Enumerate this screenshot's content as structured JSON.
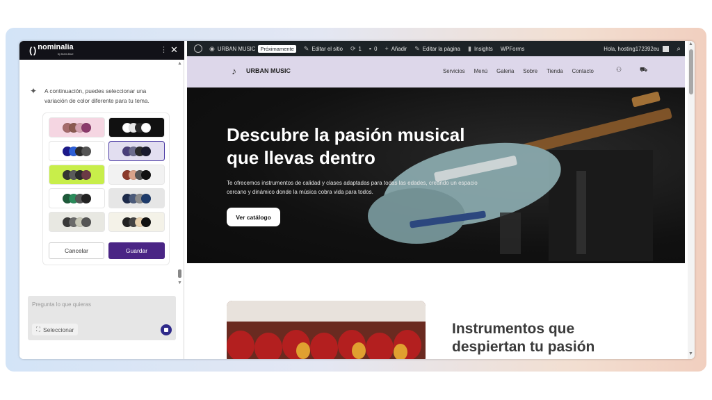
{
  "panel": {
    "brand": "nominalia",
    "brand_sub": "by team.blue",
    "message": "A continuación, puedes seleccionar una variación de color diferente para tu tema.",
    "cancel_label": "Cancelar",
    "save_label": "Guardar",
    "chat_placeholder": "Pregunta lo que quieras",
    "select_label": "Seleccionar",
    "palettes": [
      {
        "bg": "#f5d6e2",
        "colors": [
          "#a56b6b",
          "#8a5a50",
          "#d4a2b0",
          "#8b3a6b"
        ],
        "selected": false
      },
      {
        "bg": "#111111",
        "colors": [
          "#ffffff",
          "#e8e8e8",
          "#2a2a2a",
          "#ffffff"
        ],
        "selected": false
      },
      {
        "bg": "#ffffff",
        "colors": [
          "#1d1a8a",
          "#2d5fd6",
          "#2b2b2b",
          "#555555"
        ],
        "selected": false
      },
      {
        "bg": "#e2def0",
        "colors": [
          "#4a3f7a",
          "#6c6c8c",
          "#2b2b2b",
          "#1a1a2e"
        ],
        "selected": true
      },
      {
        "bg": "#c8ee4a",
        "colors": [
          "#333333",
          "#5a5a5a",
          "#2b2b2b",
          "#6b3a45"
        ],
        "selected": false
      },
      {
        "bg": "#f2f2f2",
        "colors": [
          "#8b3a2b",
          "#d9a38a",
          "#555555",
          "#111111"
        ],
        "selected": false
      },
      {
        "bg": "#ffffff",
        "colors": [
          "#1e5a3a",
          "#2a8a5a",
          "#555555",
          "#222222"
        ],
        "selected": false
      },
      {
        "bg": "#e6e6e6",
        "colors": [
          "#1d2a4a",
          "#4a5a7a",
          "#8a8a8a",
          "#1d3a6a"
        ],
        "selected": false
      },
      {
        "bg": "#e8e8e2",
        "colors": [
          "#3a3a3a",
          "#6a6a6a",
          "#c8c8b8",
          "#555555"
        ],
        "selected": false
      },
      {
        "bg": "#f4f2e8",
        "colors": [
          "#222222",
          "#444444",
          "#e8d2b0",
          "#111111"
        ],
        "selected": false
      }
    ]
  },
  "adminbar": {
    "site_name": "URBAN MUSIC",
    "badge": "Próximamente",
    "edit_site": "Editar el sitio",
    "updates": "1",
    "comments": "0",
    "add": "Añadir",
    "edit_page": "Editar la página",
    "insights": "Insights",
    "wpforms": "WPForms",
    "greeting": "Hola, hosting172392eu"
  },
  "site": {
    "title": "URBAN MUSIC",
    "nav": [
      "Servicios",
      "Menú",
      "Galeria",
      "Sobre",
      "Tienda",
      "Contacto"
    ],
    "hero_title": "Descubre la pasión musical que llevas dentro",
    "hero_desc": "Te ofrecemos instrumentos de calidad y clases adaptadas para todas las edades, creando un espacio cercano y dinámico donde la música cobra vida para todos.",
    "hero_button": "Ver catálogo",
    "section_title": "Instrumentos que despiertan tu pasión"
  }
}
